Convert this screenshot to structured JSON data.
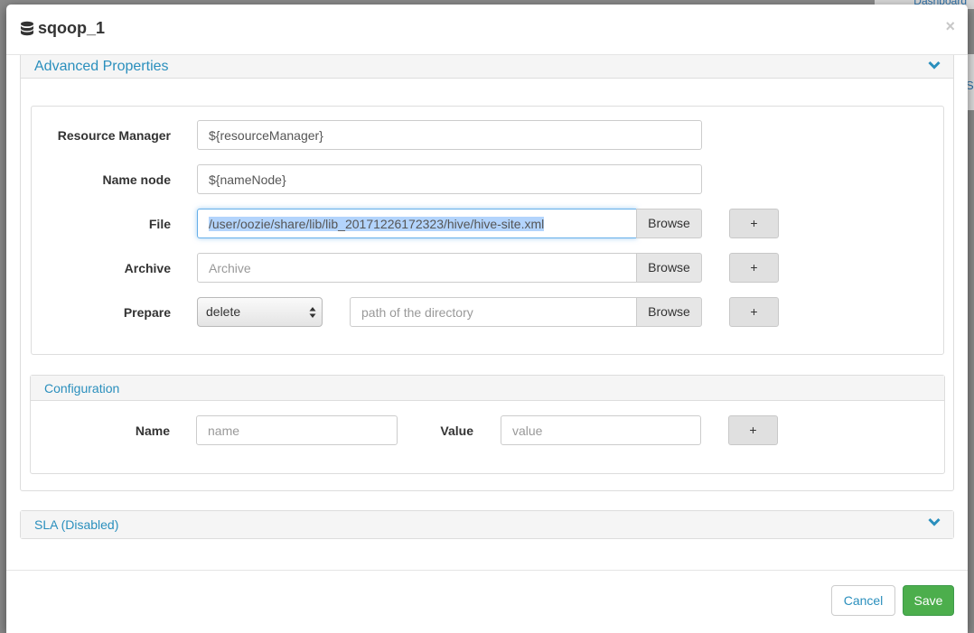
{
  "background": {
    "dashboard_link": "Dashboard",
    "right_link": "S"
  },
  "modal": {
    "title": "sqoop_1",
    "close": "×"
  },
  "advanced": {
    "title": "Advanced Properties",
    "resource_manager": {
      "label": "Resource Manager",
      "value": "${resourceManager}"
    },
    "name_node": {
      "label": "Name node",
      "value": "${nameNode}"
    },
    "file": {
      "label": "File",
      "value": "/user/oozie/share/lib/lib_20171226172323/hive/hive-site.xml",
      "browse": "Browse",
      "add": "+"
    },
    "archive": {
      "label": "Archive",
      "placeholder": "Archive",
      "browse": "Browse",
      "add": "+"
    },
    "prepare": {
      "label": "Prepare",
      "selected": "delete",
      "placeholder": "path of the directory",
      "browse": "Browse",
      "add": "+"
    }
  },
  "configuration": {
    "title": "Configuration",
    "name_label": "Name",
    "name_placeholder": "name",
    "value_label": "Value",
    "value_placeholder": "value",
    "add": "+"
  },
  "sla": {
    "title": "SLA (Disabled)"
  },
  "footer": {
    "cancel": "Cancel",
    "save": "Save"
  },
  "colors": {
    "link": "#2a8fbd",
    "save": "#4cae4c",
    "focus": "#66afe9"
  }
}
